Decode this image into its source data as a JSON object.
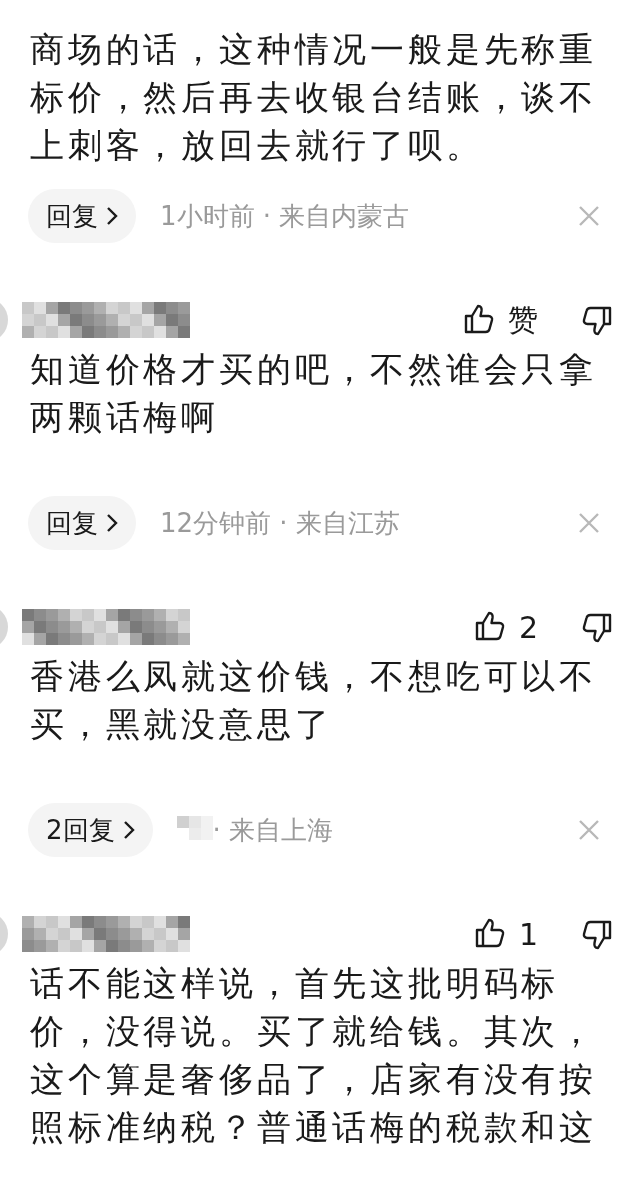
{
  "comments": [
    {
      "text": "商场的话，这种情况一般是先称重标价，然后再去收银台结账，谈不上刺客，放回去就行了呗。",
      "reply": "回复",
      "meta": "1小时前 · 来自内蒙古"
    },
    {
      "like_label": "赞",
      "text": "知道价格才买的吧，不然谁会只拿两颗话梅啊",
      "reply": "回复",
      "meta": "12分钟前 · 来自江苏"
    },
    {
      "like_label": "2",
      "text": "香港么凤就这价钱，不想吃可以不买，黑就没意思了",
      "reply": "2回复",
      "time_hidden": true,
      "meta": "· 来自上海"
    },
    {
      "like_label": "1",
      "text": "话不能这样说，首先这批明码标价，没得说。买了就给钱。其次，这个算是奢侈品了，店家有没有按照标准纳税？普通话梅的税款和这"
    }
  ]
}
